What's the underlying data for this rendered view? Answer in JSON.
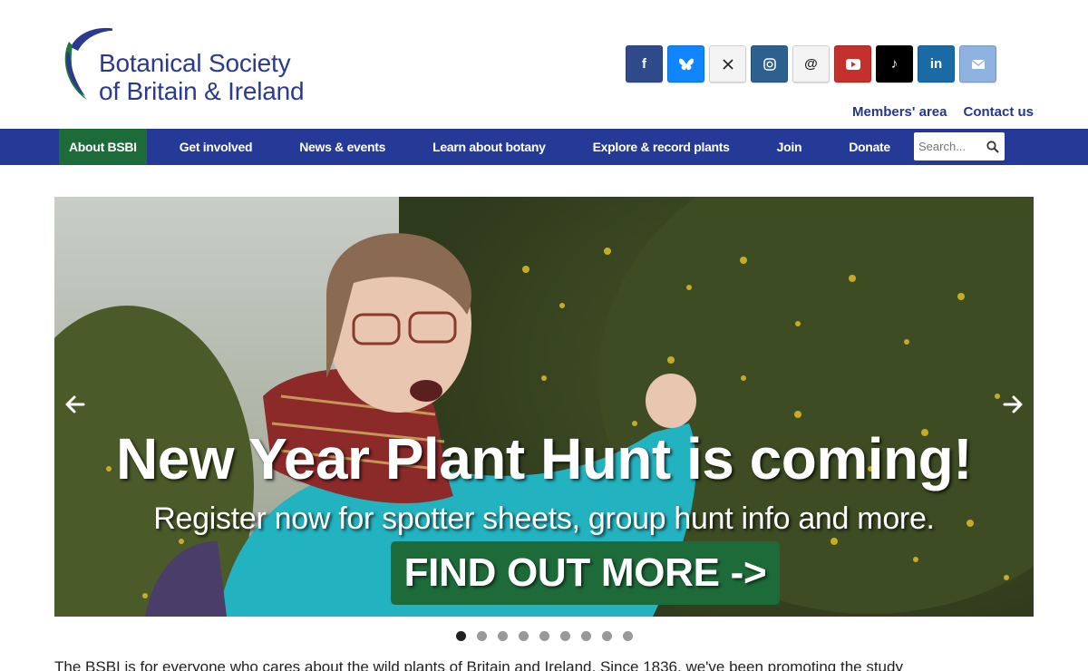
{
  "brand": {
    "line1": "Botanical Society",
    "line2": "of Britain & Ireland",
    "colors": {
      "blue": "#2b3a8f",
      "green": "#1e6b3a"
    }
  },
  "social": [
    {
      "name": "facebook",
      "glyph": "f"
    },
    {
      "name": "bluesky",
      "glyph": "🦋"
    },
    {
      "name": "x",
      "glyph": "𝕏"
    },
    {
      "name": "instagram",
      "glyph": "◎"
    },
    {
      "name": "threads",
      "glyph": "@"
    },
    {
      "name": "youtube",
      "glyph": "▶"
    },
    {
      "name": "tiktok",
      "glyph": "♪"
    },
    {
      "name": "linkedin",
      "glyph": "in"
    },
    {
      "name": "email",
      "glyph": "✉"
    }
  ],
  "toplinks": {
    "members": "Members' area",
    "contact": "Contact us"
  },
  "nav": {
    "items": [
      {
        "label": "About BSBI",
        "active": true
      },
      {
        "label": "Get involved",
        "active": false
      },
      {
        "label": "News & events",
        "active": false
      },
      {
        "label": "Learn about botany",
        "active": false
      },
      {
        "label": "Explore & record plants",
        "active": false
      },
      {
        "label": "Join",
        "active": false
      },
      {
        "label": "Donate",
        "active": false
      }
    ],
    "search_placeholder": "Search..."
  },
  "hero": {
    "title": "New Year Plant Hunt is coming!",
    "subtitle": "Register now for spotter sheets, group hunt info and more.",
    "cta": "FIND OUT MORE ->",
    "slide_count": 9,
    "active_slide": 1
  },
  "intro": "The BSBI is for everyone who cares about the wild plants of Britain and Ireland. Since 1836, we've been promoting the study"
}
